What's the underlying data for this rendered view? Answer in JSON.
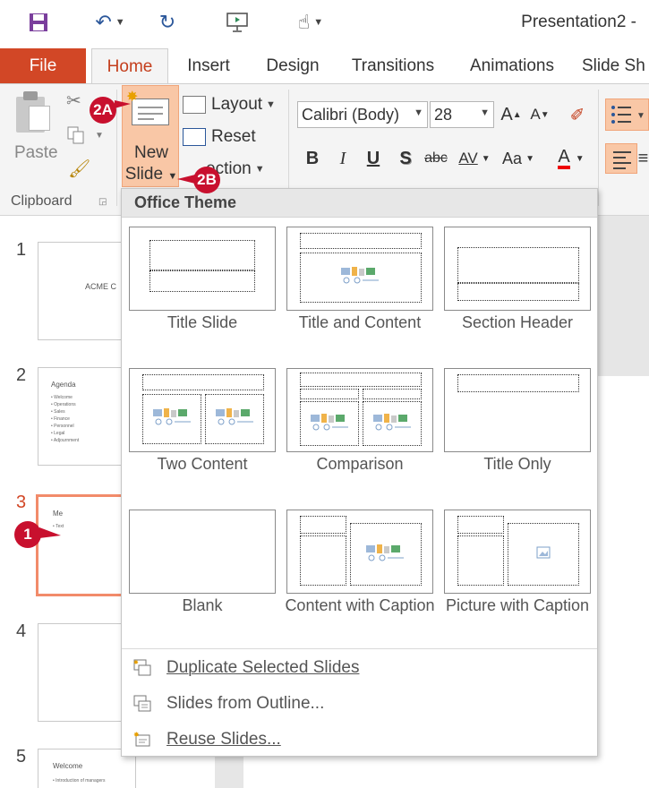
{
  "window": {
    "title": "Presentation2 -"
  },
  "ribbon_tabs": [
    {
      "label": "File"
    },
    {
      "label": "Home"
    },
    {
      "label": "Insert"
    },
    {
      "label": "Design"
    },
    {
      "label": "Transitions"
    },
    {
      "label": "Animations"
    },
    {
      "label": "Slide Sh"
    }
  ],
  "clipboard": {
    "paste_label": "Paste",
    "group_label": "Clipboard"
  },
  "slides_group": {
    "new_slide_line1": "New",
    "new_slide_line2": "Slide",
    "layout_label": "Layout",
    "reset_label": "Reset",
    "section_label": "ection"
  },
  "font_group": {
    "font_name": "Calibri (Body)",
    "font_size": "28",
    "grow": "A",
    "shrink": "A",
    "bold": "B",
    "italic": "I",
    "underline": "U",
    "shadow": "S",
    "strike": "abc",
    "spacing": "AV",
    "case": "Aa",
    "font_color": "A"
  },
  "gallery": {
    "header": "Office Theme",
    "layouts": [
      {
        "name": "Title Slide"
      },
      {
        "name": "Title and Content"
      },
      {
        "name": "Section Header"
      },
      {
        "name": "Two Content"
      },
      {
        "name": "Comparison"
      },
      {
        "name": "Title Only"
      },
      {
        "name": "Blank"
      },
      {
        "name": "Content with Caption"
      },
      {
        "name": "Picture with Caption"
      }
    ],
    "menu": [
      {
        "label": "Duplicate Selected Slides"
      },
      {
        "label": "Slides from Outline..."
      },
      {
        "label": "Reuse Slides..."
      }
    ]
  },
  "thumbnails": [
    {
      "number": "1",
      "title": "ACME C"
    },
    {
      "number": "2",
      "title": "Agenda",
      "bullets": [
        "Welcome",
        "Operations",
        "Sales",
        "Finance",
        "Personnel",
        "Legal",
        "Adjournment"
      ]
    },
    {
      "number": "3",
      "title": "Me",
      "bullets": [
        "Text"
      ]
    },
    {
      "number": "4"
    },
    {
      "number": "5",
      "title": "Welcome",
      "bullets": [
        "Introduction of managers"
      ]
    }
  ],
  "callouts": {
    "one": "1",
    "two_a": "2A",
    "two_b": "2B"
  },
  "colors": {
    "accent": "#d24726",
    "highlight": "#f9c7a6",
    "callout": "#c8102e"
  }
}
